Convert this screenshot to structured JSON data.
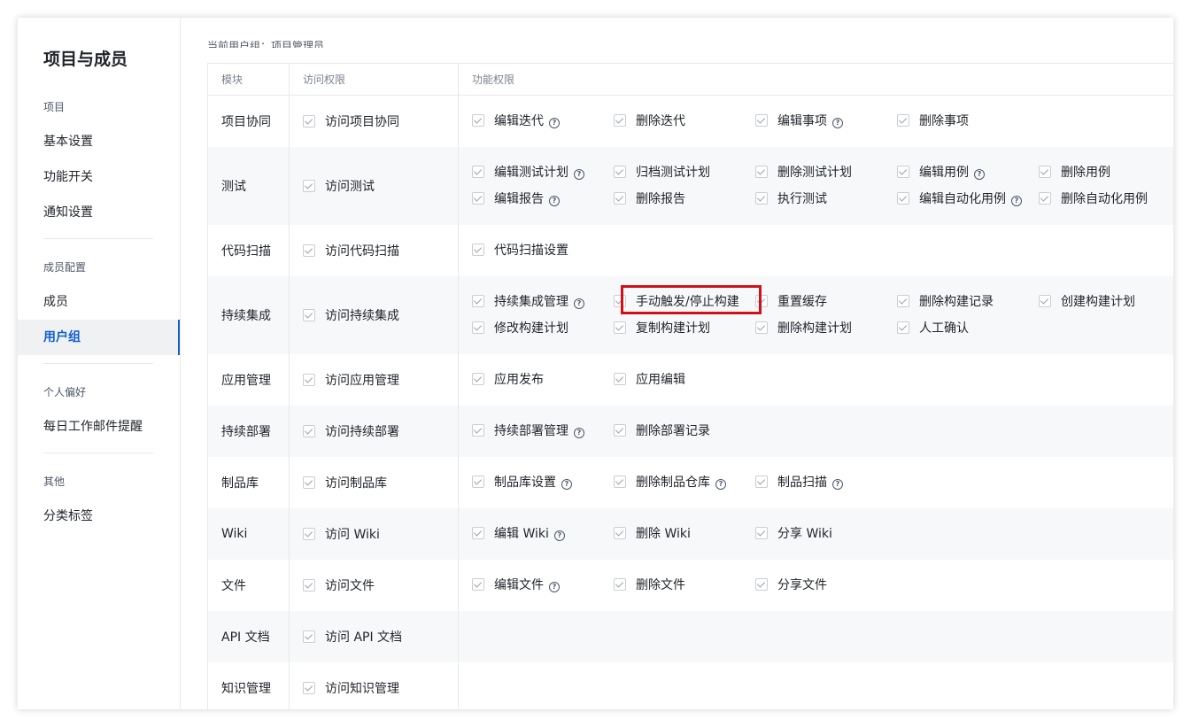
{
  "sidebar": {
    "title": "项目与成员",
    "sections": [
      {
        "header": "项目",
        "items": [
          "基本设置",
          "功能开关",
          "通知设置"
        ]
      },
      {
        "header": "成员配置",
        "items": [
          "成员",
          "用户组"
        ]
      },
      {
        "header": "个人偏好",
        "items": [
          "每日工作邮件提醒"
        ]
      },
      {
        "header": "其他",
        "items": [
          "分类标签"
        ]
      }
    ],
    "active_item": "用户组"
  },
  "current_group": "当前用户组：项目管理员",
  "table": {
    "headers": [
      "模块",
      "访问权限",
      "功能权限"
    ],
    "rows": [
      {
        "module": "项目协同",
        "access": "访问项目协同",
        "perms": [
          {
            "label": "编辑迭代",
            "help": true
          },
          {
            "label": "删除迭代",
            "help": false
          },
          {
            "label": "编辑事项",
            "help": true
          },
          {
            "label": "删除事项",
            "help": false
          }
        ]
      },
      {
        "module": "测试",
        "access": "访问测试",
        "perms": [
          {
            "label": "编辑测试计划",
            "help": true
          },
          {
            "label": "归档测试计划",
            "help": false
          },
          {
            "label": "删除测试计划",
            "help": false
          },
          {
            "label": "编辑用例",
            "help": true
          },
          {
            "label": "删除用例",
            "help": false
          },
          {
            "label": "编辑报告",
            "help": true
          },
          {
            "label": "删除报告",
            "help": false
          },
          {
            "label": "执行测试",
            "help": false
          },
          {
            "label": "编辑自动化用例",
            "help": true
          },
          {
            "label": "删除自动化用例",
            "help": false
          }
        ]
      },
      {
        "module": "代码扫描",
        "access": "访问代码扫描",
        "perms": [
          {
            "label": "代码扫描设置",
            "help": false
          }
        ]
      },
      {
        "module": "持续集成",
        "access": "访问持续集成",
        "perms": [
          {
            "label": "持续集成管理",
            "help": true
          },
          {
            "label": "手动触发/停止构建",
            "help": false
          },
          {
            "label": "重置缓存",
            "help": false
          },
          {
            "label": "删除构建记录",
            "help": false
          },
          {
            "label": "创建构建计划",
            "help": false
          },
          {
            "label": "修改构建计划",
            "help": false
          },
          {
            "label": "复制构建计划",
            "help": false
          },
          {
            "label": "删除构建计划",
            "help": false
          },
          {
            "label": "人工确认",
            "help": false
          }
        ]
      },
      {
        "module": "应用管理",
        "access": "访问应用管理",
        "perms": [
          {
            "label": "应用发布",
            "help": false
          },
          {
            "label": "应用编辑",
            "help": false
          }
        ]
      },
      {
        "module": "持续部署",
        "access": "访问持续部署",
        "perms": [
          {
            "label": "持续部署管理",
            "help": true
          },
          {
            "label": "删除部署记录",
            "help": false
          }
        ]
      },
      {
        "module": "制品库",
        "access": "访问制品库",
        "perms": [
          {
            "label": "制品库设置",
            "help": true
          },
          {
            "label": "删除制品仓库",
            "help": true
          },
          {
            "label": "制品扫描",
            "help": true
          }
        ]
      },
      {
        "module": "Wiki",
        "access": "访问 Wiki",
        "perms": [
          {
            "label": "编辑 Wiki",
            "help": true
          },
          {
            "label": "删除 Wiki",
            "help": false
          },
          {
            "label": "分享 Wiki",
            "help": false
          }
        ]
      },
      {
        "module": "文件",
        "access": "访问文件",
        "perms": [
          {
            "label": "编辑文件",
            "help": true
          },
          {
            "label": "删除文件",
            "help": false
          },
          {
            "label": "分享文件",
            "help": false
          }
        ]
      },
      {
        "module": "API 文档",
        "access": "访问 API 文档",
        "perms": []
      },
      {
        "module": "知识管理",
        "access": "访问知识管理",
        "perms": []
      }
    ]
  },
  "highlight_color": "#d0101a",
  "accent_color": "#1060d0"
}
